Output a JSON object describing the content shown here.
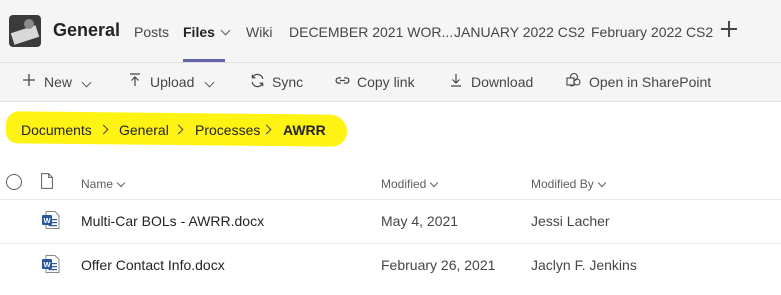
{
  "header": {
    "channel_name": "General",
    "tabs": [
      {
        "label": "Posts"
      },
      {
        "label": "Files"
      },
      {
        "label": "Wiki"
      },
      {
        "label": "DECEMBER 2021 WOR..."
      },
      {
        "label": "JANUARY 2022 CS2"
      },
      {
        "label": "February 2022 CS2"
      }
    ],
    "active_tab": "Files",
    "accent_color": "#6264a7"
  },
  "commands": {
    "new_label": "New",
    "upload_label": "Upload",
    "sync_label": "Sync",
    "copy_link_label": "Copy link",
    "download_label": "Download",
    "sharepoint_label": "Open in SharePoint"
  },
  "breadcrumb": [
    "Documents",
    "General",
    "Processes",
    "AWRR"
  ],
  "highlight_color": "#fff200",
  "columns": {
    "name": "Name",
    "modified": "Modified",
    "modified_by": "Modified By"
  },
  "files": [
    {
      "name": "Multi-Car BOLs - AWRR.docx",
      "modified": "May 4, 2021",
      "modified_by": "Jessi Lacher",
      "icon": "word-doc-icon"
    },
    {
      "name": "Offer Contact Info.docx",
      "modified": "February 26, 2021",
      "modified_by": "Jaclyn F. Jenkins",
      "icon": "word-doc-icon"
    }
  ]
}
